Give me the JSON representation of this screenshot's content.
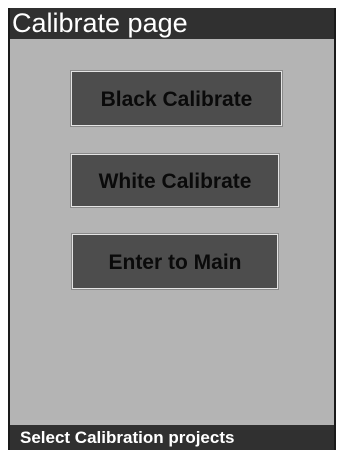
{
  "header": {
    "title": "Calibrate page"
  },
  "menu": {
    "buttons": [
      {
        "label": "Black Calibrate"
      },
      {
        "label": "White Calibrate"
      },
      {
        "label": "Enter to Main"
      }
    ]
  },
  "footer": {
    "status": "Select Calibration projects"
  },
  "colors": {
    "background": "#b4b4b4",
    "bar": "#303030",
    "button": "#4d4d4d",
    "button_border": "#e4e4e4",
    "text_light": "#ffffff",
    "text_dark": "#0a0a0a"
  }
}
